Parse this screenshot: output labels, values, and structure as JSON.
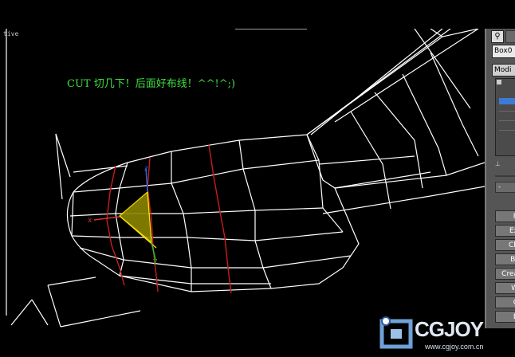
{
  "viewport": {
    "label": "tive",
    "annotation": "CUT 切几下！后面好布线！^^!^;)"
  },
  "command_panel": {
    "object_name": "Box0",
    "modifier_list": "Modi",
    "rollout_collapse": "-",
    "buttons": [
      "R",
      "Ex",
      "Ch",
      "Br",
      "Crea",
      "W",
      "C",
      "B"
    ]
  },
  "watermark": {
    "logo_text": "CGJOY",
    "url": "www.cgjoy.com.cn"
  },
  "colors": {
    "wire": "#ffffff",
    "cut_edge": "#c81e1e",
    "annotation": "#3fe23f",
    "gizmo_face": "#b8b400"
  },
  "icons": [
    "zoom-icon",
    "pin-icon",
    "axis-gizmo-icon"
  ]
}
